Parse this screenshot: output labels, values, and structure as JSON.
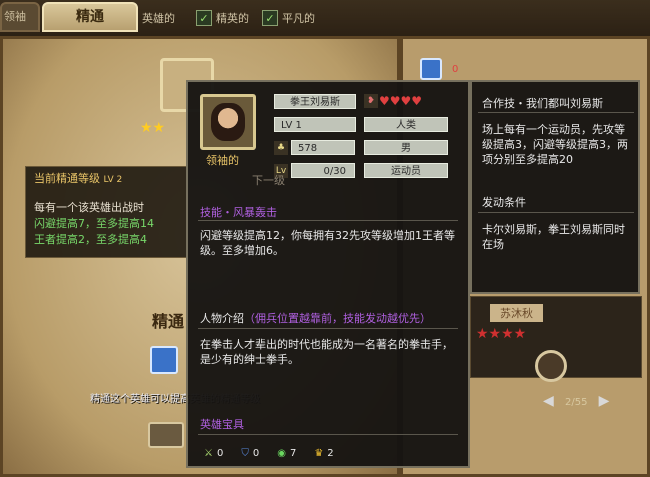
{
  "top_bar": {
    "tab_inactive_label": "领袖",
    "tab_active_label": "精通",
    "filters": [
      {
        "label": "英雄的",
        "checked": true
      },
      {
        "label": "精英的",
        "checked": true
      },
      {
        "label": "平凡的",
        "checked": true
      }
    ]
  },
  "main_panel": {
    "level_box": {
      "title": "当前精通等级",
      "level": "LV 2",
      "line1": "每有一个该英雄出战时",
      "line2": "闪避提高7，至多提高14",
      "line3": "王者提高2，至多提高4"
    },
    "section_label": "精通",
    "bottom_desc": "精通这个英雄可以提高英雄的精通等级"
  },
  "right_panel": {
    "hero_name": "苏沐秋",
    "pager": "2/55",
    "blue_count": "0"
  },
  "tooltip": {
    "hero_name": "拳王刘易斯",
    "level": "LV 1",
    "race": "人类",
    "power": "578",
    "gender": "男",
    "exp": "0/30",
    "job": "运动员",
    "leader_label": "领袖的",
    "hearts": 4,
    "ghost_next": "下一级",
    "ghost_line": "每有一个该英雄出战时",
    "skill_title": "技能・风暴轰击",
    "skill_desc": "闪避等级提高12，你每拥有32先攻等级增加1王者等级。至多增加6。",
    "intro_title": "人物介绍",
    "intro_note": "（佣兵位置越靠前，技能发动越优先）",
    "intro_desc": "在拳击人才辈出的时代也能成为一名著名的拳击手，是少有的绅士拳手。",
    "treasure_title": "英雄宝具",
    "treasures": [
      {
        "icon": "sword-icon",
        "count": "0"
      },
      {
        "icon": "shield-icon",
        "count": "0"
      },
      {
        "icon": "ring-icon",
        "count": "7"
      },
      {
        "icon": "crown-icon",
        "count": "2"
      }
    ]
  },
  "combo_panel": {
    "title": "合作技・我们都叫刘易斯",
    "desc": "场上每有一个运动员，先攻等级提高3，闪避等级提高3，两项分别至多提高20",
    "condition_title": "发动条件",
    "condition_desc": "卡尔刘易斯，拳王刘易斯同时在场"
  },
  "colors": {
    "accent_gold": "#e8c468",
    "skill_purple": "#b060e0",
    "green": "#78d86a"
  }
}
